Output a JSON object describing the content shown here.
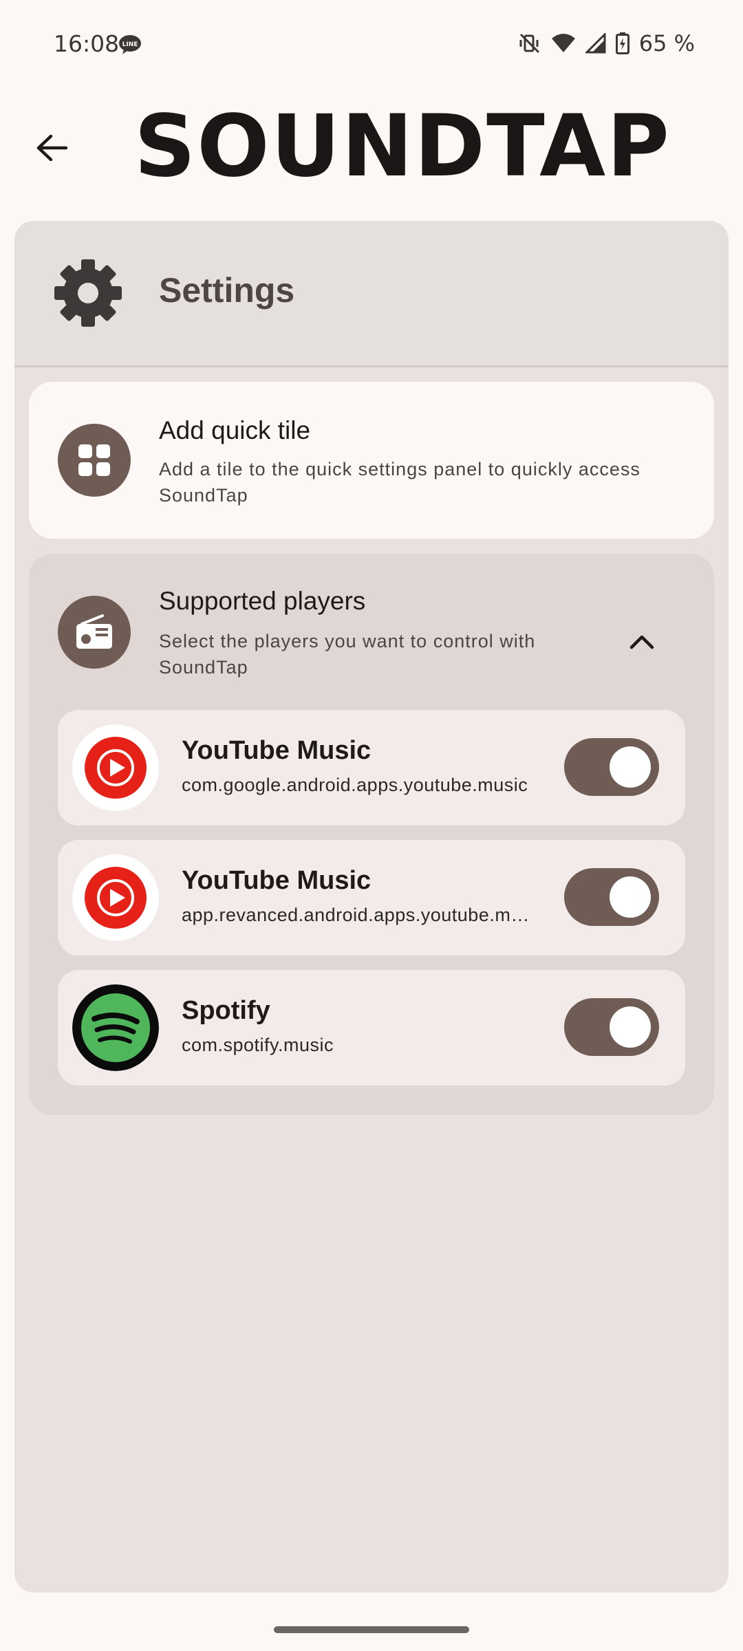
{
  "status_bar": {
    "time": "16:08",
    "battery": "65 %",
    "notification_badge": "LINE"
  },
  "header": {
    "brand": "SOUNDTAP"
  },
  "settings_sheet": {
    "title": "Settings",
    "quick_tile": {
      "title": "Add quick tile",
      "description": "Add a tile to the quick settings panel to quickly access SoundTap"
    },
    "supported_players": {
      "title": "Supported players",
      "description": "Select the players you want to control with SoundTap",
      "players": [
        {
          "name": "YouTube Music",
          "package": "com.google.android.apps.youtube.music",
          "enabled": true
        },
        {
          "name": "YouTube Music",
          "package": "app.revanced.android.apps.youtube.music",
          "enabled": true
        },
        {
          "name": "Spotify",
          "package": "com.spotify.music",
          "enabled": true
        }
      ]
    }
  },
  "colors": {
    "accent": "#6e5c55",
    "youtube_red": "#e62117",
    "spotify_green": "#1db954"
  },
  "icons": {
    "back": "arrow-back-icon",
    "settings": "gear-icon",
    "quick_tile": "grid-icon",
    "players": "radio-icon",
    "collapse": "chevron-up-icon"
  }
}
